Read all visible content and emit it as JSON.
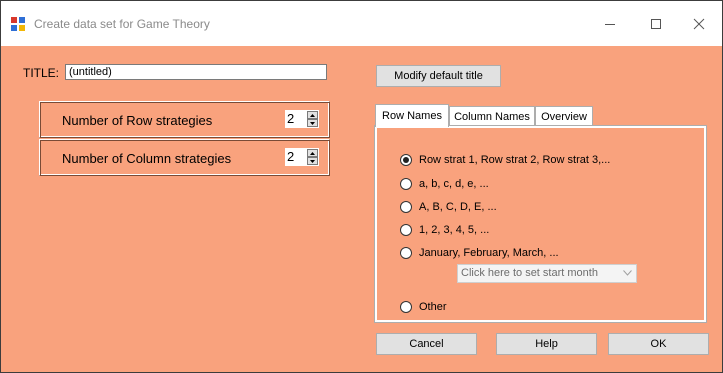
{
  "window": {
    "title": "Create data set for Game Theory",
    "controls": {
      "minimize": "minimize-icon",
      "maximize": "maximize-icon",
      "close": "close-icon"
    }
  },
  "title_field": {
    "label": "TITLE:",
    "value": "(untitled)"
  },
  "modify_button": "Modify default title",
  "strategies": {
    "rows": {
      "label": "Number of Row strategies",
      "value": "2"
    },
    "columns": {
      "label": "Number of Column strategies",
      "value": "2"
    }
  },
  "tabs": [
    {
      "label": "Row Names",
      "active": true
    },
    {
      "label": "Column Names",
      "active": false
    },
    {
      "label": "Overview",
      "active": false
    }
  ],
  "row_names_options": [
    {
      "label": "Row strat 1, Row strat 2, Row strat 3,...",
      "checked": true
    },
    {
      "label": "a, b, c, d, e, ...",
      "checked": false
    },
    {
      "label": "A, B, C, D, E, ...",
      "checked": false
    },
    {
      "label": "1, 2, 3, 4, 5, ...",
      "checked": false
    },
    {
      "label": "January, February, March, ...",
      "checked": false
    },
    {
      "label": "Other",
      "checked": false
    }
  ],
  "start_month_select": {
    "value": "Click here to set start month"
  },
  "buttons": {
    "cancel": "Cancel",
    "help": "Help",
    "ok": "OK"
  },
  "colors": {
    "background": "#f9a27d",
    "button": "#e1e1e1"
  }
}
